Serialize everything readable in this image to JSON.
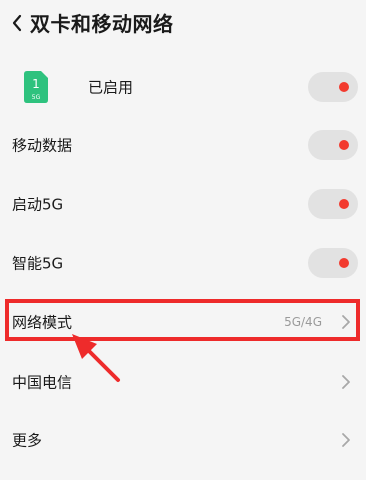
{
  "header": {
    "title": "双卡和移动网络",
    "back_icon": "chevron-left-icon"
  },
  "sim": {
    "card_number": "1",
    "card_type": "5G",
    "status_label": "已启用",
    "enabled": true
  },
  "rows": {
    "mobile_data": {
      "label": "移动数据",
      "enabled": true
    },
    "enable_5g": {
      "label": "启动5G",
      "enabled": true
    },
    "smart_5g": {
      "label": "智能5G",
      "enabled": true
    },
    "network_mode": {
      "label": "网络模式",
      "value": "5G/4G"
    },
    "carrier": {
      "label": "中国电信"
    },
    "more": {
      "label": "更多"
    }
  },
  "colors": {
    "toggle_knob": "#f23a2e",
    "toggle_track": "#e2e2e2",
    "highlight": "#ee2b2b",
    "sim_green": "#2ec27e"
  }
}
